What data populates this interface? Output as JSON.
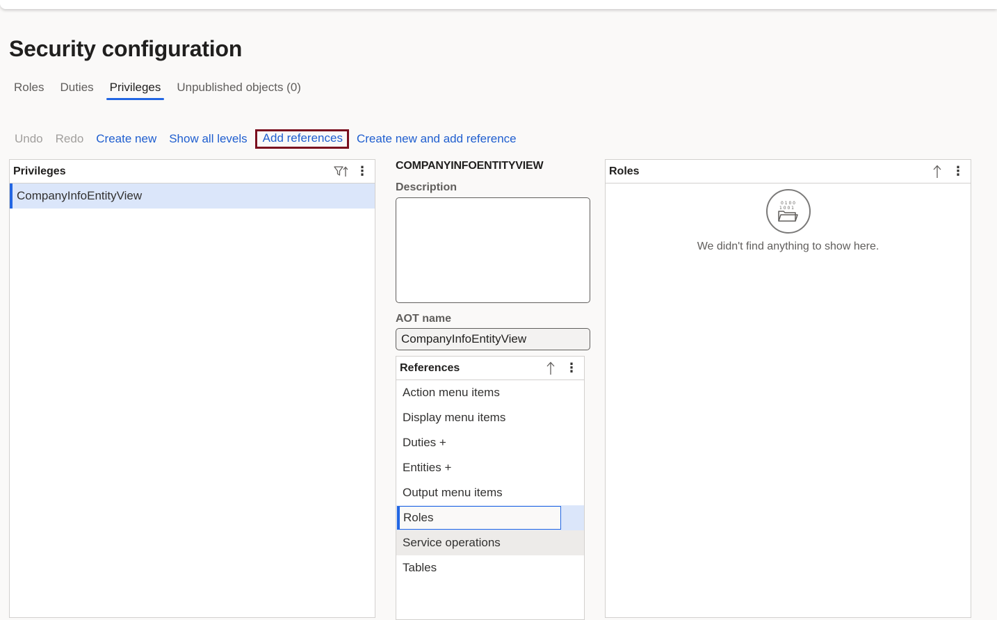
{
  "page": {
    "title": "Security configuration"
  },
  "tabs": [
    {
      "label": "Roles",
      "active": false
    },
    {
      "label": "Duties",
      "active": false
    },
    {
      "label": "Privileges",
      "active": true
    },
    {
      "label": "Unpublished objects (0)",
      "active": false
    }
  ],
  "toolbar": {
    "undo": "Undo",
    "redo": "Redo",
    "create_new": "Create new",
    "show_all_levels": "Show all levels",
    "add_references": "Add references",
    "create_new_and_add_reference": "Create new and add reference"
  },
  "privileges_panel": {
    "title": "Privileges",
    "filter_icon": "filter-sort-icon",
    "more_icon": "more-vertical-icon",
    "items": [
      {
        "label": "CompanyInfoEntityView",
        "selected": true
      }
    ]
  },
  "details": {
    "heading": "COMPANYINFOENTITYVIEW",
    "description_label": "Description",
    "description_value": "",
    "aot_label": "AOT name",
    "aot_value": "CompanyInfoEntityView"
  },
  "references_panel": {
    "title": "References",
    "sort_icon": "sort-up-icon",
    "more_icon": "more-vertical-icon",
    "items": [
      {
        "label": "Action menu items"
      },
      {
        "label": "Display menu items"
      },
      {
        "label": "Duties +"
      },
      {
        "label": "Entities +"
      },
      {
        "label": "Output menu items"
      },
      {
        "label": "Roles",
        "state": "focused"
      },
      {
        "label": "Service operations",
        "state": "hovered"
      },
      {
        "label": "Tables"
      }
    ]
  },
  "roles_panel": {
    "title": "Roles",
    "sort_icon": "sort-up-icon",
    "more_icon": "more-vertical-icon",
    "empty_icon": "empty-folder-icon",
    "empty_message": "We didn't find anything to show here."
  },
  "colors": {
    "accent": "#2266e3",
    "link": "#1f5ecf",
    "highlight_border": "#7a0f1f",
    "selected_row": "#dbe6fa",
    "background": "#faf9f8"
  }
}
